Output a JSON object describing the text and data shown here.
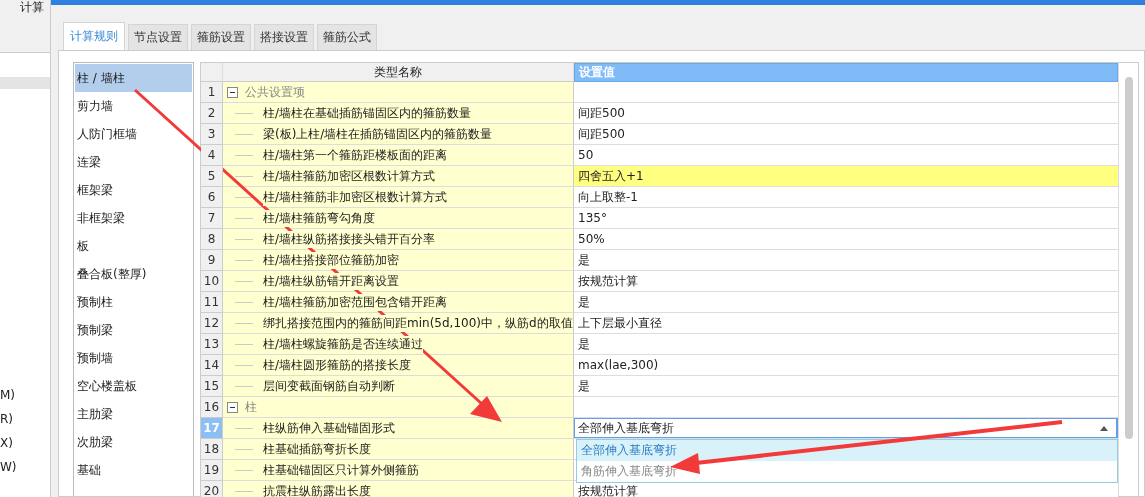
{
  "background_window": {
    "title": "计算",
    "items": [
      "M)",
      "R)",
      "X)",
      "W)"
    ]
  },
  "tabs": [
    {
      "label": "计算规则",
      "selected": true
    },
    {
      "label": "节点设置",
      "selected": false
    },
    {
      "label": "箍筋设置",
      "selected": false
    },
    {
      "label": "搭接设置",
      "selected": false
    },
    {
      "label": "箍筋公式",
      "selected": false
    }
  ],
  "categories": [
    {
      "label": "柱 / 墙柱",
      "selected": true
    },
    {
      "label": "剪力墙",
      "selected": false
    },
    {
      "label": "人防门框墙",
      "selected": false
    },
    {
      "label": "连梁",
      "selected": false
    },
    {
      "label": "框架梁",
      "selected": false
    },
    {
      "label": "非框架梁",
      "selected": false
    },
    {
      "label": "板",
      "selected": false
    },
    {
      "label": "叠合板(整厚)",
      "selected": false
    },
    {
      "label": "预制柱",
      "selected": false
    },
    {
      "label": "预制梁",
      "selected": false
    },
    {
      "label": "预制墙",
      "selected": false
    },
    {
      "label": "空心楼盖板",
      "selected": false
    },
    {
      "label": "主肋梁",
      "selected": false
    },
    {
      "label": "次肋梁",
      "selected": false
    },
    {
      "label": "基础",
      "selected": false
    }
  ],
  "table": {
    "columns": [
      "类型名称",
      "设置值"
    ],
    "rows": [
      {
        "number": "1",
        "kind": "group",
        "name": "公共设置项",
        "expanded": true,
        "selected": false,
        "highlighted": false
      },
      {
        "number": "2",
        "kind": "setting",
        "name": "柱/墙柱在基础插筋锚固区内的箍筋数量",
        "value": "间距500",
        "selected": false,
        "highlighted": false
      },
      {
        "number": "3",
        "kind": "setting",
        "name": "梁(板)上柱/墙柱在插筋锚固区内的箍筋数量",
        "value": "间距500",
        "selected": false,
        "highlighted": false
      },
      {
        "number": "4",
        "kind": "setting",
        "name": "柱/墙柱第一个箍筋距楼板面的距离",
        "value": "50",
        "selected": false,
        "highlighted": false
      },
      {
        "number": "5",
        "kind": "setting",
        "name": "柱/墙柱箍筋加密区根数计算方式",
        "value": "四舍五入+1",
        "selected": false,
        "highlighted": true
      },
      {
        "number": "6",
        "kind": "setting",
        "name": "柱/墙柱箍筋非加密区根数计算方式",
        "value": "向上取整-1",
        "selected": false,
        "highlighted": false
      },
      {
        "number": "7",
        "kind": "setting",
        "name": "柱/墙柱箍筋弯勾角度",
        "value": "135°",
        "selected": false,
        "highlighted": false
      },
      {
        "number": "8",
        "kind": "setting",
        "name": "柱/墙柱纵筋搭接接头错开百分率",
        "value": "50%",
        "selected": false,
        "highlighted": false
      },
      {
        "number": "9",
        "kind": "setting",
        "name": "柱/墙柱搭接部位箍筋加密",
        "value": "是",
        "selected": false,
        "highlighted": false
      },
      {
        "number": "10",
        "kind": "setting",
        "name": "柱/墙柱纵筋错开距离设置",
        "value": "按规范计算",
        "selected": false,
        "highlighted": false
      },
      {
        "number": "11",
        "kind": "setting",
        "name": "柱/墙柱箍筋加密范围包含错开距离",
        "value": "是",
        "selected": false,
        "highlighted": false
      },
      {
        "number": "12",
        "kind": "setting",
        "name": "绑扎搭接范围内的箍筋间距min(5d,100)中，纵筋d的取值",
        "value": "上下层最小直径",
        "selected": false,
        "highlighted": false
      },
      {
        "number": "13",
        "kind": "setting",
        "name": "柱/墙柱螺旋箍筋是否连续通过",
        "value": "是",
        "selected": false,
        "highlighted": false
      },
      {
        "number": "14",
        "kind": "setting",
        "name": "柱/墙柱圆形箍筋的搭接长度",
        "value": "max(lae,300)",
        "selected": false,
        "highlighted": false
      },
      {
        "number": "15",
        "kind": "setting",
        "name": "层间变截面钢筋自动判断",
        "value": "是",
        "selected": false,
        "highlighted": false
      },
      {
        "number": "16",
        "kind": "group",
        "name": "柱",
        "expanded": true,
        "selected": false,
        "highlighted": false
      },
      {
        "number": "17",
        "kind": "dropdown",
        "name": "柱纵筋伸入基础锚固形式",
        "value": "全部伸入基底弯折",
        "selected": true,
        "highlighted": false,
        "options": [
          {
            "label": "全部伸入基底弯折",
            "selected": true
          },
          {
            "label": "角筋伸入基底弯折",
            "selected": false
          }
        ]
      },
      {
        "number": "18",
        "kind": "setting",
        "name": "柱基础插筋弯折长度",
        "selected": false,
        "highlighted": false
      },
      {
        "number": "19",
        "kind": "setting",
        "name": "柱基础锚固区只计算外侧箍筋",
        "selected": false,
        "highlighted": false
      },
      {
        "number": "20",
        "kind": "setting",
        "name": "抗震柱纵筋露出长度",
        "value": "按规范计算",
        "selected": false,
        "highlighted": false
      }
    ]
  }
}
